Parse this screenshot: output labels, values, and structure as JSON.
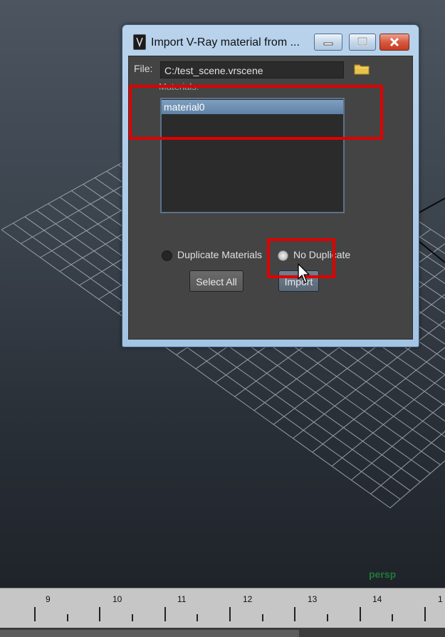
{
  "dialog": {
    "title": "Import V-Ray material from ...",
    "file_label": "File:",
    "file_value": "C:/test_scene.vrscene",
    "materials_label": "Materials:",
    "materials": [
      "material0"
    ],
    "selected_material": "material0",
    "options": [
      {
        "label": "Duplicate Materials",
        "selected": false
      },
      {
        "label": "No Duplicate",
        "selected": true
      }
    ],
    "select_all_label": "Select All",
    "import_label": "Import",
    "icons": [
      "vray-app-icon",
      "minimize-icon",
      "maximize-icon",
      "close-icon",
      "folder-icon"
    ]
  },
  "viewport": {
    "camera_label": "persp"
  },
  "timeline": {
    "frames": [
      "9",
      "10",
      "11",
      "12",
      "13",
      "14",
      "1"
    ]
  },
  "colors": {
    "highlight": "#e00000",
    "selection": "#6f91b4",
    "panel": "#444444"
  }
}
